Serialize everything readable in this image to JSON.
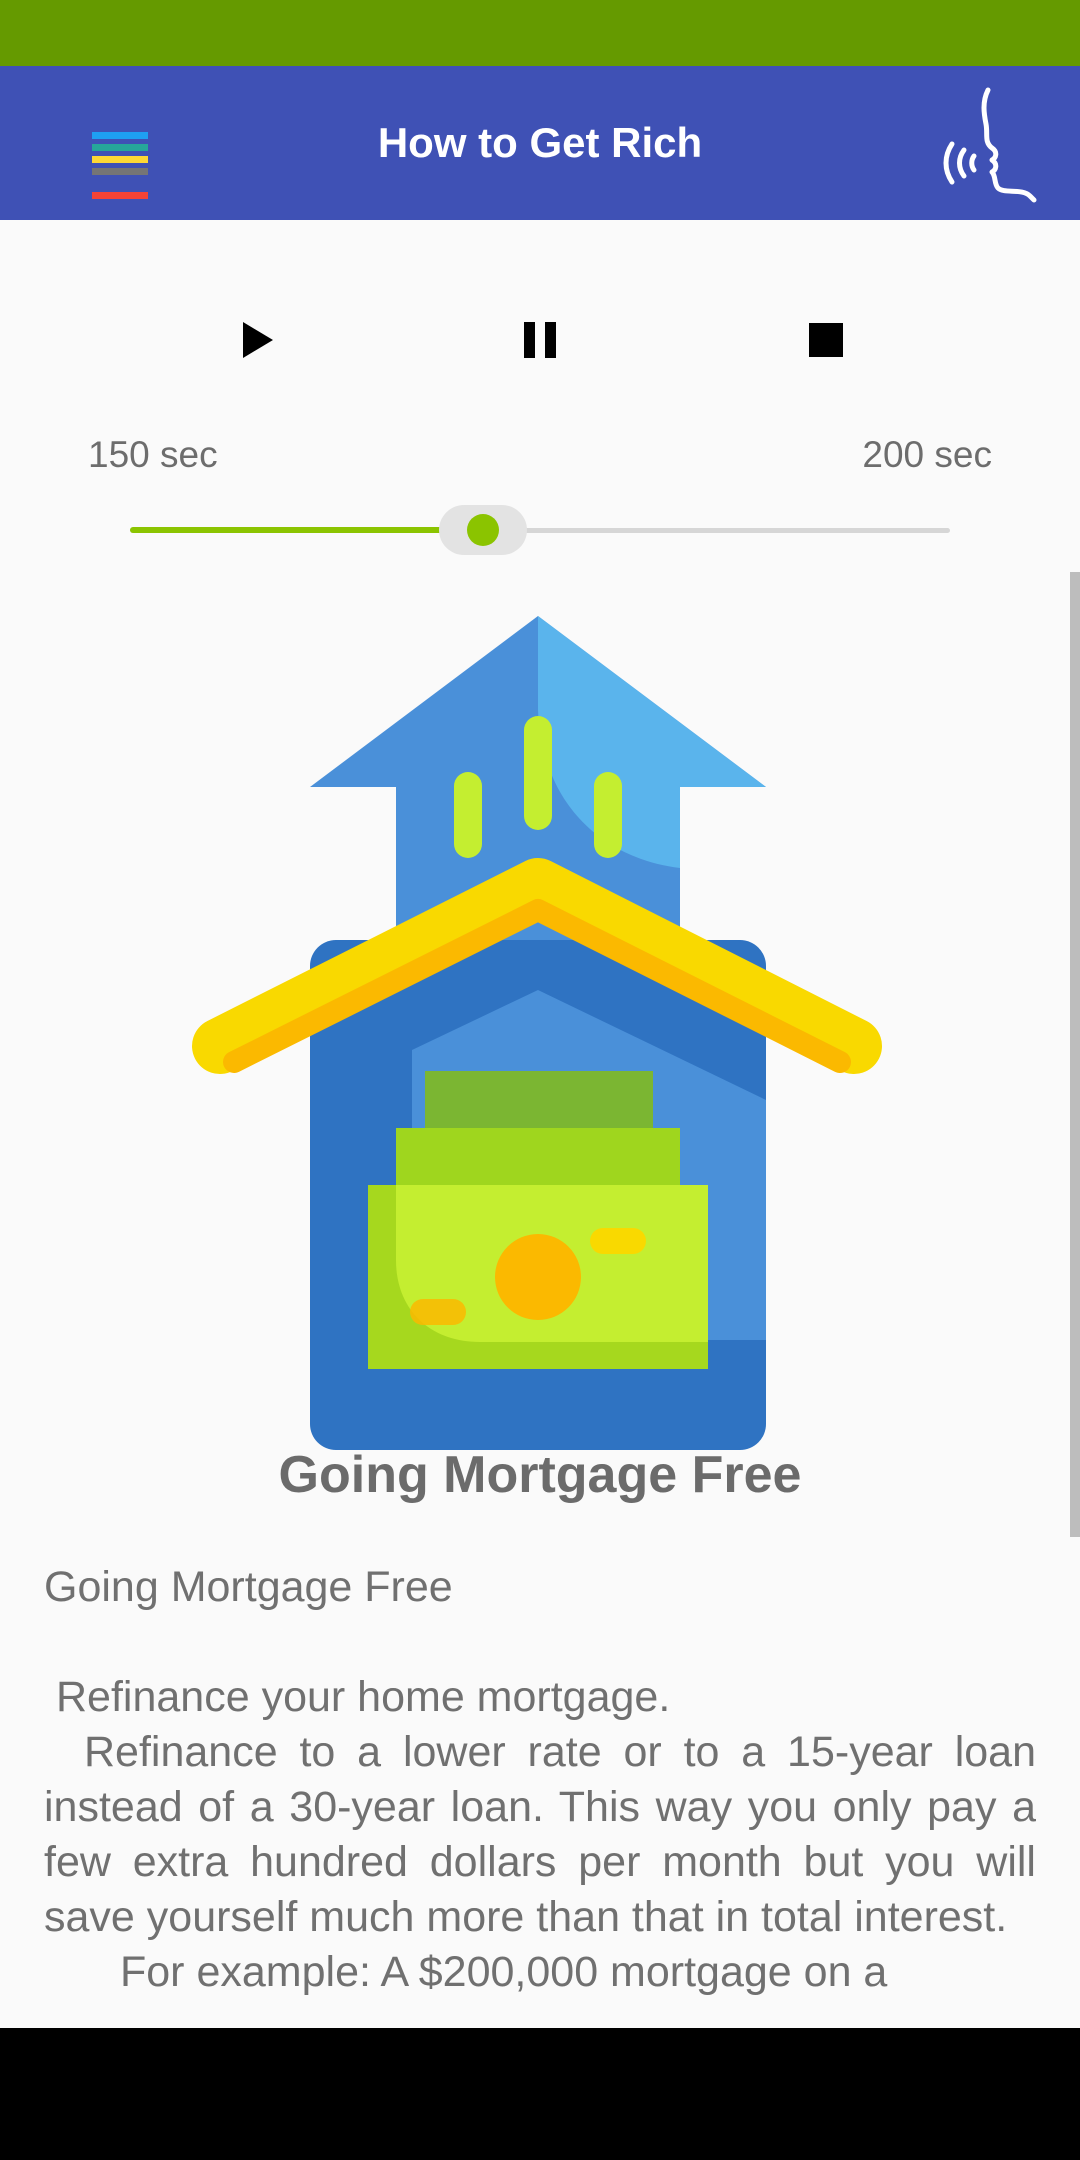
{
  "status_bar": {
    "color": "#659a00"
  },
  "app_bar": {
    "title": "How to Get Rich",
    "color": "#3f51b5",
    "menu_icon": "colorful-hamburger-menu-icon",
    "menu_colors": [
      "#1e9ff2",
      "#26a69a",
      "#fdd835",
      "#757575",
      "#f44336"
    ],
    "speak_icon": "speaking-head-icon"
  },
  "player": {
    "play_icon": "play-icon",
    "pause_icon": "pause-icon",
    "stop_icon": "stop-icon",
    "current_time": "150 sec",
    "total_time": "200 sec",
    "progress_fraction": 0.43,
    "accent": "#8bc400"
  },
  "article": {
    "illustration": "house-with-arrow-and-money-icon",
    "heading": "Going Mortgage Free",
    "section_title": "Going Mortgage Free",
    "subtitle": "Refinance your home mortgage.",
    "paragraph": "Refinance to a lower rate or to a 15-year loan instead of a 30-year loan. This way you only pay a few extra hundred dollars per month but you will save yourself much more than that in total interest.",
    "paragraph_2": "For example: A $200,000 mortgage on a"
  }
}
